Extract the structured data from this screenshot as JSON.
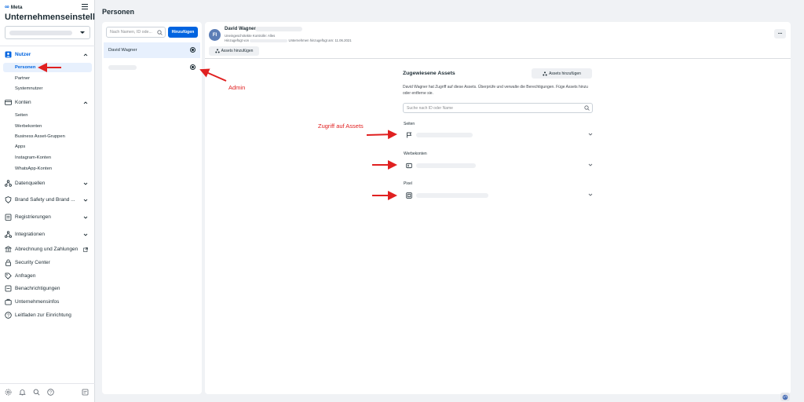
{
  "sidebar": {
    "logo_text": "Meta",
    "title": "Unternehmenseinstellungen",
    "groups": {
      "nutzer": "Nutzer",
      "konten": "Konten",
      "datenquellen": "Datenquellen",
      "brand_safety": "Brand Safety und Brand ...",
      "registrierungen": "Registrierungen",
      "integrationen": "Integrationen",
      "abrechnung": "Abrechnung und Zahlungen",
      "security": "Security Center",
      "anfragen": "Anfragen",
      "benachrichtigungen": "Benachrichtigungen",
      "unternehmensinfos": "Unternehmensinfos",
      "leitfaden": "Leitfaden zur Einrichtung"
    },
    "nutzer_items": [
      "Personen",
      "Partner",
      "Systemnutzer"
    ],
    "konten_items": [
      "Seiten",
      "Werbekonten",
      "Business Asset-Gruppen",
      "Apps",
      "Instagram-Konten",
      "WhatsApp-Konten"
    ]
  },
  "main": {
    "page_title": "Personen"
  },
  "list": {
    "search_placeholder": "Nach Namen, ID ode...",
    "add_button": "Hinzufügen",
    "people": [
      "David Wagner"
    ]
  },
  "detail": {
    "avatar_initials": "FI",
    "name": "David Wagner",
    "meta1": "Uneingeschränkte Kontrolle: Alles",
    "meta2_a": "Hinzugefügt von",
    "meta2_b": "Unternehmen hinzugefügt am: 11.06.2021",
    "more": "···",
    "assets_add_top": "Assets hinzufügen",
    "assigned_title": "Zugewiesene Assets",
    "assets_add_right": "Assets hinzufügen",
    "assigned_desc": "David Wagner hat Zugriff auf diese Assets. Überprüfe und verwalte die Berechtigungen. Füge Assets hinzu oder entferne sie.",
    "search_placeholder": "Suche nach ID oder Name",
    "sections": [
      "Seiten",
      "Werbekonten",
      "Pixel"
    ]
  },
  "annotations": {
    "admin": "Admin",
    "zugriff": "Zugriff auf Assets"
  },
  "colors": {
    "accent": "#0064e0",
    "annotation": "#e02020"
  }
}
